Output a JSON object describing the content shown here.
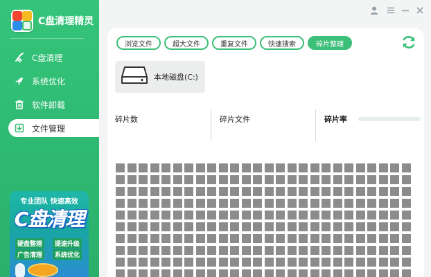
{
  "app": {
    "title": "C盘清理精灵"
  },
  "sidebar": {
    "items": [
      {
        "label": "C盘清理",
        "icon": "broom-icon",
        "active": false
      },
      {
        "label": "系统优化",
        "icon": "rocket-icon",
        "active": false
      },
      {
        "label": "软件卸载",
        "icon": "trash-icon",
        "active": false
      },
      {
        "label": "文件管理",
        "icon": "file-download-icon",
        "active": true
      }
    ]
  },
  "promo": {
    "headline": "专业团队 快速高效",
    "big_text": "C盘清理",
    "tags": [
      "硬盘整理",
      "提速升级",
      "广告清理",
      "系统优化"
    ]
  },
  "window": {
    "buttons": [
      "user-icon",
      "menu-icon",
      "minimize-icon",
      "close-icon"
    ]
  },
  "tabs": [
    {
      "label": "浏览文件",
      "active": false
    },
    {
      "label": "超大文件",
      "active": false
    },
    {
      "label": "重复文件",
      "active": false
    },
    {
      "label": "快速搜索",
      "active": false
    },
    {
      "label": "碎片整理",
      "active": true
    }
  ],
  "disk": {
    "label": "本地磁盘(C:)"
  },
  "stats": {
    "fragment_count_label": "碎片数",
    "fragment_files_label": "碎片文件",
    "fragment_rate_label": "碎片率"
  },
  "fragment_map": {
    "columns": 26,
    "rows": 10,
    "state": "unanalyzed"
  },
  "colors": {
    "accent": "#3cbf78",
    "sidebar": "#2fbb73",
    "block": "#8c8c8c"
  }
}
